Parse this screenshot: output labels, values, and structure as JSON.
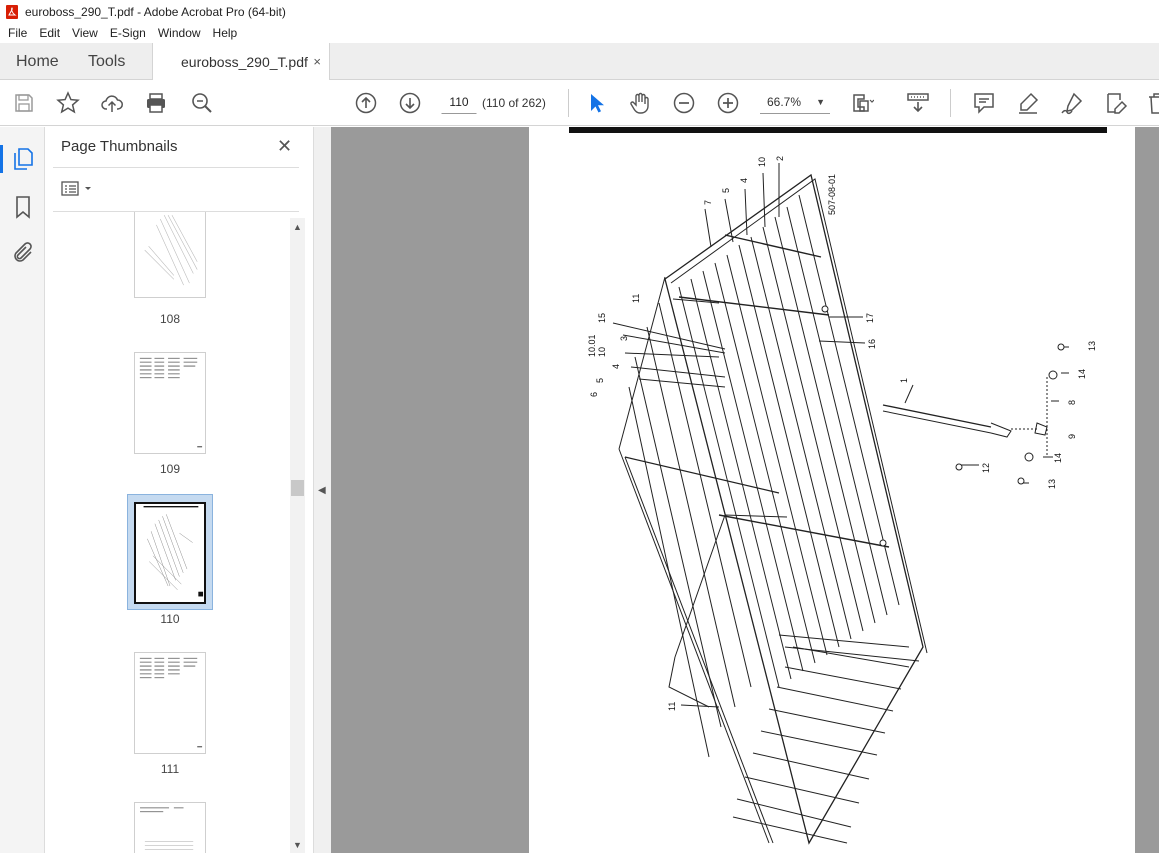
{
  "window": {
    "title": "euroboss_290_T.pdf - Adobe Acrobat Pro (64-bit)"
  },
  "menu": [
    "File",
    "Edit",
    "View",
    "E-Sign",
    "Window",
    "Help"
  ],
  "tabs": {
    "home": "Home",
    "tools": "Tools",
    "document": "euroboss_290_T.pdf",
    "close": "×"
  },
  "toolbar": {
    "page_value": "110",
    "page_count": "(110 of 262)",
    "zoom": "66.7%",
    "icons": [
      "save-icon",
      "star-icon",
      "upload-icon",
      "print-icon",
      "zoom-search-icon",
      "page-up-icon",
      "page-down-icon",
      "select-arrow-icon",
      "hand-icon",
      "zoom-out-icon",
      "zoom-in-icon",
      "page-fit-icon",
      "scroll-mode-icon",
      "comment-icon",
      "highlight-icon",
      "sign-icon",
      "edit-icon",
      "trash-icon"
    ]
  },
  "panel": {
    "title": "Page Thumbnails",
    "close": "✕",
    "thumbnails": [
      {
        "label": "108",
        "selected": false
      },
      {
        "label": "109",
        "selected": false
      },
      {
        "label": "110",
        "selected": true
      },
      {
        "label": "111",
        "selected": false
      }
    ]
  },
  "drawing": {
    "doc_code": "507-08-01",
    "callouts": [
      "10",
      "2",
      "4",
      "5",
      "7",
      "11",
      "15",
      "3",
      "10.01",
      "10",
      "4",
      "5",
      "6",
      "17",
      "16",
      "1",
      "13",
      "14",
      "8",
      "9",
      "12",
      "14",
      "13",
      "11"
    ]
  }
}
